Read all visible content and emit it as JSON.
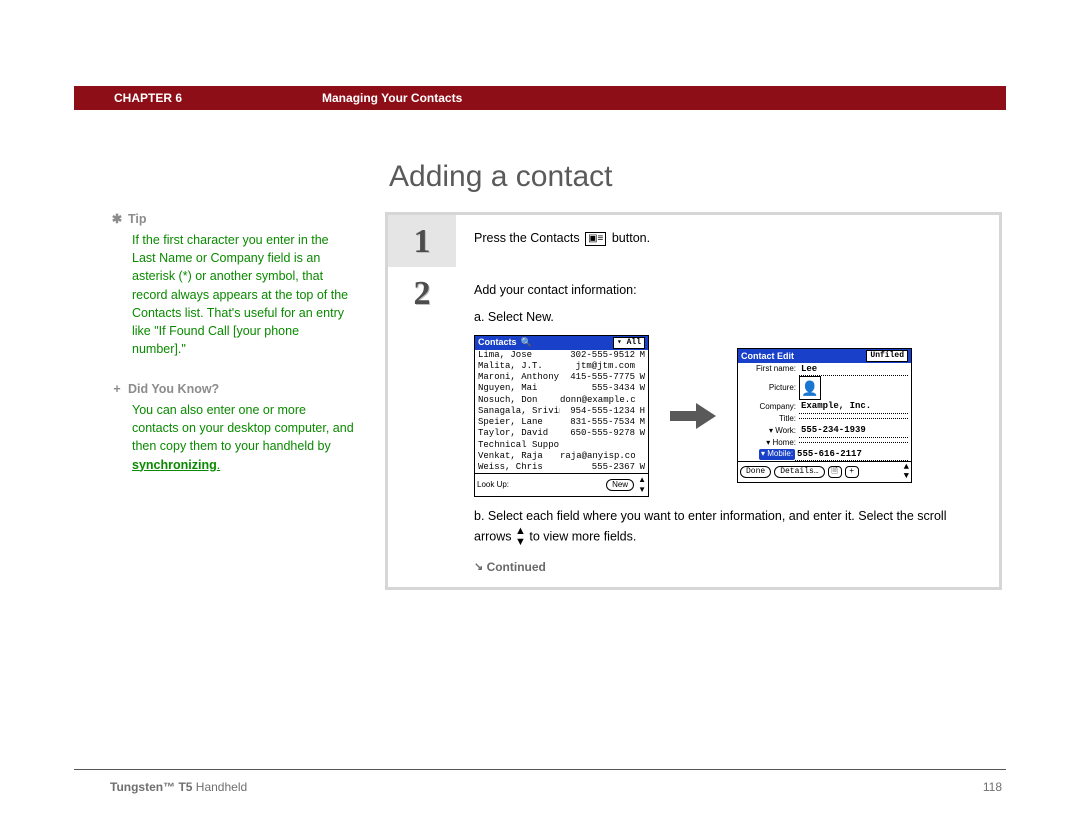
{
  "header": {
    "chapter": "CHAPTER 6",
    "title": "Managing Your Contacts"
  },
  "page": {
    "title": "Adding a contact",
    "number": "118"
  },
  "product": {
    "bold": "Tungsten™ T5",
    "rest": " Handheld"
  },
  "sidebar": {
    "tip": {
      "heading": "Tip",
      "body": "If the first character you enter in the Last Name or Company field is an asterisk (*) or another symbol, that record always appears at the top of the Contacts list. That's useful for an entry like \"If Found Call [your phone number].\""
    },
    "dyk": {
      "heading": "Did You Know?",
      "body_before_link": "You can also enter one or more contacts on your desktop computer, and then copy them to your handheld by ",
      "link": "synchronizing"
    }
  },
  "steps": {
    "one": {
      "num": "1",
      "text_a": "Press the Contacts ",
      "text_b": " button."
    },
    "two": {
      "num": "2",
      "intro": "Add your contact information:",
      "a": "a.  Select New.",
      "b_a": "b.  Select each field where you want to enter information, and enter it. Select the scroll arrows ",
      "b_b": " to view more fields."
    },
    "continued": "Continued"
  },
  "contacts_screen": {
    "title": "Contacts",
    "filter": "▾ All",
    "lookup": "Look Up:",
    "new_btn": "New",
    "rows": [
      {
        "n": "Lima, Jose",
        "v": "302-555-9512",
        "t": "M"
      },
      {
        "n": "Malita, J.T.",
        "v": "jtm@jtm.com",
        "t": ""
      },
      {
        "n": "Maroni, Anthony",
        "v": "415-555-7775",
        "t": "W"
      },
      {
        "n": "Nguyen, Mai",
        "v": "555-3434",
        "t": "W"
      },
      {
        "n": "Nosuch, Don",
        "v": "donn@example.com",
        "t": ""
      },
      {
        "n": "Sanagala, Srivinas",
        "v": "954-555-1234",
        "t": "H"
      },
      {
        "n": "Speier, Lane",
        "v": "831-555-7534",
        "t": "M"
      },
      {
        "n": "Taylor, David",
        "v": "650-555-9278",
        "t": "W"
      },
      {
        "n": "Technical Support",
        "v": "",
        "t": ""
      },
      {
        "n": "Venkat, Raja",
        "v": "raja@anyisp.com",
        "t": ""
      },
      {
        "n": "Weiss, Chris",
        "v": "555-2367",
        "t": "W"
      }
    ]
  },
  "edit_screen": {
    "title": "Contact Edit",
    "unfiled": "Unfiled",
    "first_name_lbl": "First name:",
    "first_name_val": "Lee",
    "picture_lbl": "Picture:",
    "company_lbl": "Company:",
    "company_val": "Example, Inc.",
    "title_lbl": "Title:",
    "work_lbl": "Work:",
    "work_val": "555-234-1939",
    "home_lbl": "Home:",
    "mobile_lbl": "Mobile:",
    "mobile_val": "555-616-2117",
    "done": "Done",
    "details": "Details…"
  }
}
